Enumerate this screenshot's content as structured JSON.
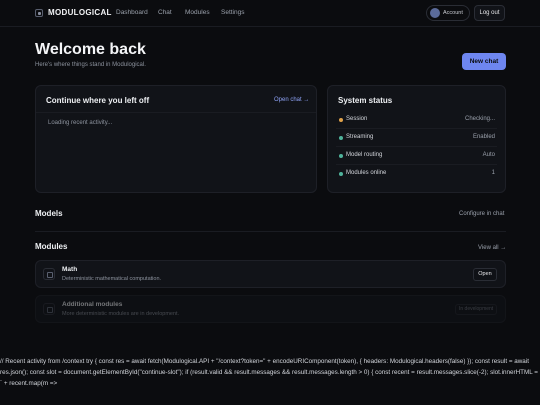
{
  "topbar": {
    "brand": "MODULOGICAL",
    "nav": [
      "Dashboard",
      "Chat",
      "Modules",
      "Settings"
    ],
    "account_label": "Account",
    "logout_label": "Log out"
  },
  "header": {
    "title": "Welcome back",
    "subtitle": "Here's where things stand in Modulogical.",
    "new_chat_label": "New chat"
  },
  "continue_card": {
    "title": "Continue where you left off",
    "link": "Open chat →",
    "loading": "Loading recent activity..."
  },
  "status_card": {
    "title": "System status",
    "rows": [
      {
        "label": "Session",
        "value": "Checking...",
        "color": "#e0a24a"
      },
      {
        "label": "Streaming",
        "value": "Enabled",
        "color": "#4fb39b"
      },
      {
        "label": "Model routing",
        "value": "Auto",
        "color": "#4fb39b"
      },
      {
        "label": "Modules online",
        "value": "1",
        "color": "#4fb39b"
      }
    ]
  },
  "models": {
    "title": "Models",
    "link": "Configure in chat"
  },
  "modules": {
    "title": "Modules",
    "link": "View all →",
    "items": [
      {
        "name": "Math",
        "desc": "Deterministic mathematical computation.",
        "action": "Open"
      },
      {
        "name": "Additional modules",
        "desc": "More deterministic modules are in development.",
        "badge": "In development"
      }
    ]
  },
  "code_dump": "// Recent activity from /context try { const res = await fetch(Modulogical.API + \"/context?token=\" + encodeURIComponent(token), { headers: Modulogical.headers(false) }); const result = await res.json(); const slot = document.getElementById(\"continue-slot\"); if (result.valid && result.messages && result.messages.length > 0) { const recent = result.messages.slice(-2); slot.innerHTML = ` + recent.map(m =>"
}
